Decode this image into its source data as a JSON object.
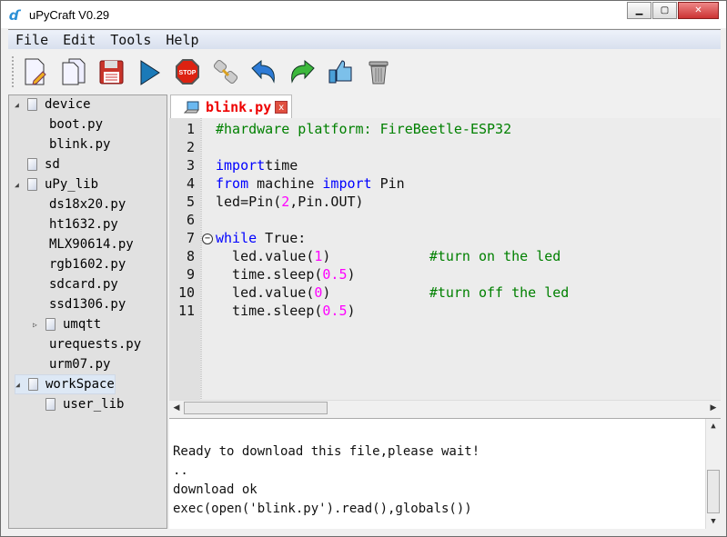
{
  "window": {
    "title": "uPyCraft V0.29"
  },
  "menu": [
    "File",
    "Edit",
    "Tools",
    "Help"
  ],
  "toolbar": [
    {
      "icon": "new-file-icon"
    },
    {
      "icon": "open-file-icon"
    },
    {
      "icon": "save-icon"
    },
    {
      "icon": "run-icon"
    },
    {
      "icon": "stop-icon"
    },
    {
      "icon": "connect-icon"
    },
    {
      "icon": "undo-icon"
    },
    {
      "icon": "redo-icon"
    },
    {
      "icon": "syntax-check-icon"
    },
    {
      "icon": "clear-icon"
    }
  ],
  "stop_label": "STOP",
  "tree": [
    {
      "label": "device",
      "level": 0,
      "arrow": "◢",
      "icon": true
    },
    {
      "label": "boot.py",
      "level": 1
    },
    {
      "label": "blink.py",
      "level": 1
    },
    {
      "label": "sd",
      "level": 0,
      "icon": true
    },
    {
      "label": "uPy_lib",
      "level": 0,
      "arrow": "◢",
      "icon": true
    },
    {
      "label": "ds18x20.py",
      "level": 1
    },
    {
      "label": "ht1632.py",
      "level": 1
    },
    {
      "label": "MLX90614.py",
      "level": 1
    },
    {
      "label": "rgb1602.py",
      "level": 1
    },
    {
      "label": "sdcard.py",
      "level": 1
    },
    {
      "label": "ssd1306.py",
      "level": 1
    },
    {
      "label": "umqtt",
      "level": 1,
      "arrow": "▷",
      "icon": true
    },
    {
      "label": "urequests.py",
      "level": 1
    },
    {
      "label": "urm07.py",
      "level": 1
    },
    {
      "label": "workSpace",
      "level": 0,
      "arrow": "◢",
      "icon": true,
      "selected": true
    },
    {
      "label": "user_lib",
      "level": 1,
      "icon": true
    }
  ],
  "tab": {
    "name": "blink.py",
    "close": "x"
  },
  "code": [
    [
      [
        "cm",
        "#hardware platform: FireBeetle-ESP32"
      ]
    ],
    [],
    [
      [
        "kw",
        "import"
      ],
      [
        "",
        "time"
      ]
    ],
    [
      [
        "kw",
        "from"
      ],
      [
        "",
        " machine "
      ],
      [
        "kw",
        "import"
      ],
      [
        "",
        " Pin"
      ]
    ],
    [
      [
        "",
        "led=Pin("
      ],
      [
        "num",
        "2"
      ],
      [
        "",
        ",Pin.OUT)"
      ]
    ],
    [],
    [
      [
        "kw",
        "while"
      ],
      [
        "",
        " True:"
      ]
    ],
    [
      [
        "",
        "  led.value("
      ],
      [
        "num",
        "1"
      ],
      [
        "",
        ")            "
      ],
      [
        "cm",
        "#turn on the led"
      ]
    ],
    [
      [
        "",
        "  time.sleep("
      ],
      [
        "num",
        "0.5"
      ],
      [
        "",
        ")"
      ]
    ],
    [
      [
        "",
        "  led.value("
      ],
      [
        "num",
        "0"
      ],
      [
        "",
        ")            "
      ],
      [
        "cm",
        "#turn off the led"
      ]
    ],
    [
      [
        "",
        "  time.sleep("
      ],
      [
        "num",
        "0.5"
      ],
      [
        "",
        ")"
      ]
    ]
  ],
  "console": [
    "",
    "Ready to download this file,please wait!",
    "..",
    "download ok",
    "exec(open('blink.py').read(),globals())"
  ]
}
